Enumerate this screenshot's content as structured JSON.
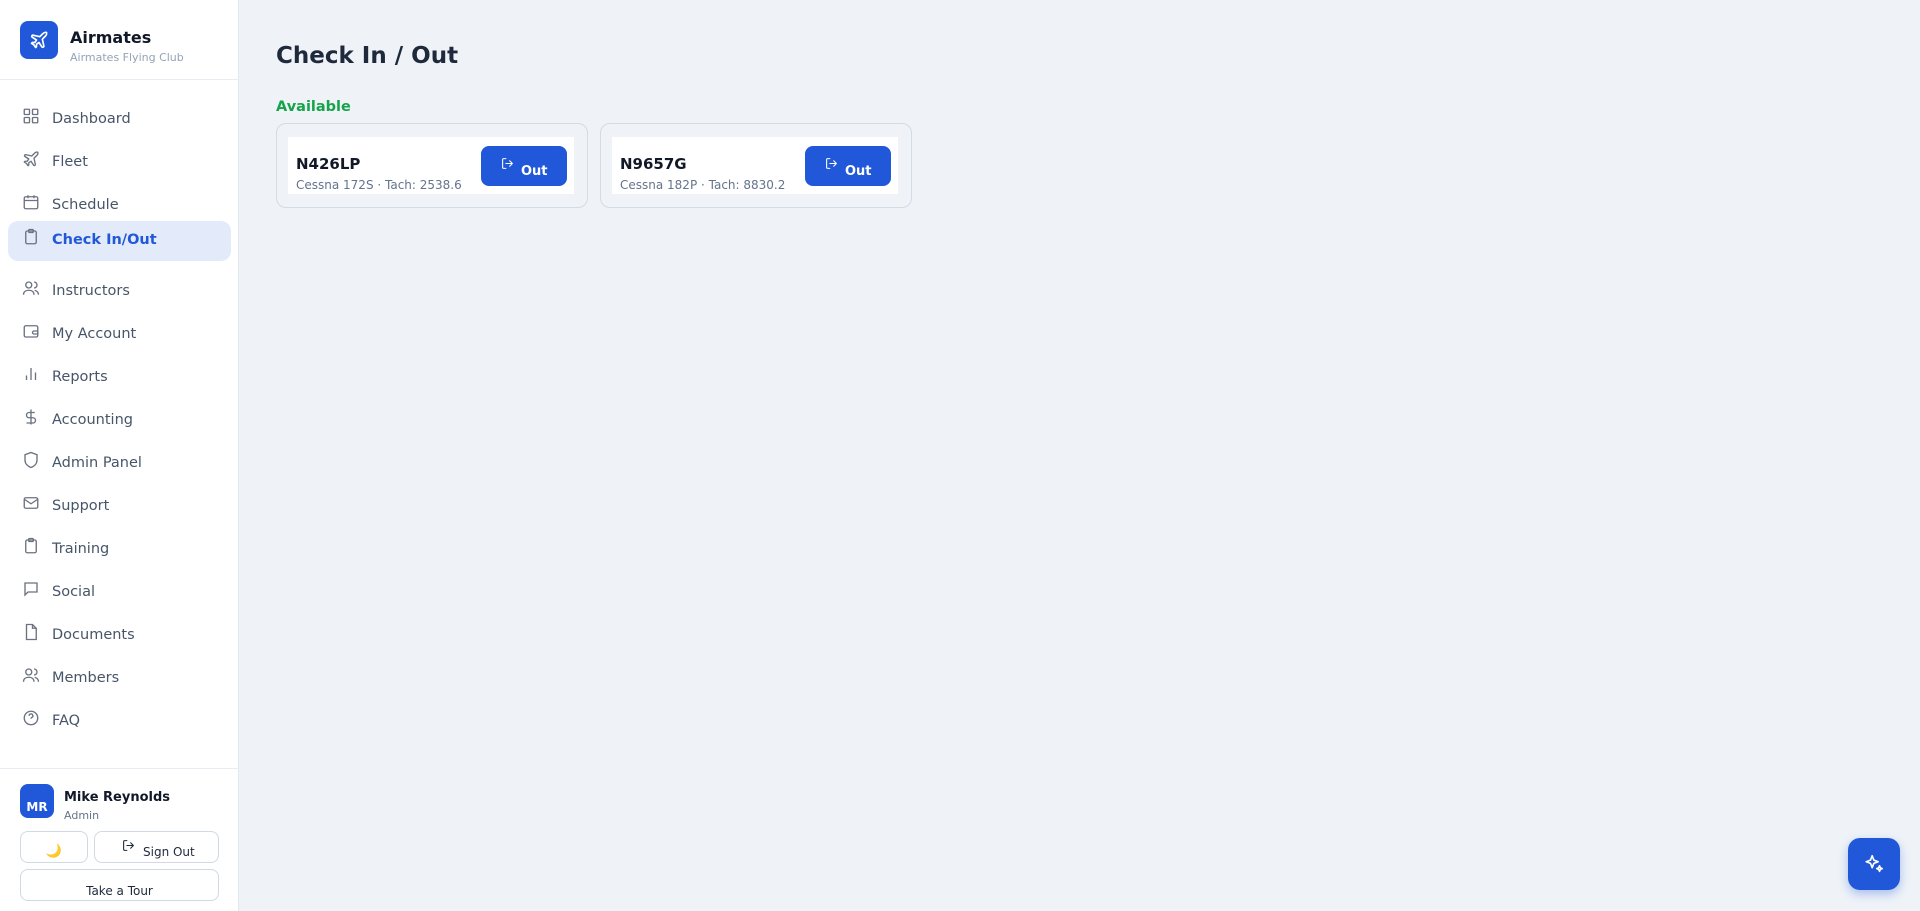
{
  "brand": {
    "name": "Airmates",
    "subtitle": "Airmates Flying Club",
    "logo_icon": "plane-icon"
  },
  "nav": [
    {
      "label": "Dashboard",
      "icon": "grid-icon",
      "active": false
    },
    {
      "label": "Fleet",
      "icon": "plane-icon",
      "active": false
    },
    {
      "label": "Schedule",
      "icon": "calendar-icon",
      "active": false
    },
    {
      "label": "Check In/Out",
      "icon": "clipboard-icon",
      "active": true
    },
    {
      "label": "Instructors",
      "icon": "users-icon",
      "active": false
    },
    {
      "label": "My Account",
      "icon": "wallet-icon",
      "active": false
    },
    {
      "label": "Reports",
      "icon": "bar-chart-icon",
      "active": false
    },
    {
      "label": "Accounting",
      "icon": "dollar-icon",
      "active": false
    },
    {
      "label": "Admin Panel",
      "icon": "shield-icon",
      "active": false
    },
    {
      "label": "Support",
      "icon": "mail-icon",
      "active": false
    },
    {
      "label": "Training",
      "icon": "clipboard-icon",
      "active": false
    },
    {
      "label": "Social",
      "icon": "message-icon",
      "active": false
    },
    {
      "label": "Documents",
      "icon": "file-icon",
      "active": false
    },
    {
      "label": "Members",
      "icon": "users-icon",
      "active": false
    },
    {
      "label": "FAQ",
      "icon": "help-circle-icon",
      "active": false
    }
  ],
  "user": {
    "initials": "MR",
    "name": "Mike Reynolds",
    "role": "Admin"
  },
  "actions": {
    "theme_icon": "🌙",
    "sign_out": "Sign Out",
    "tour": "Take a Tour"
  },
  "page": {
    "title": "Check In / Out",
    "section": "Available"
  },
  "aircraft": [
    {
      "tail": "N426LP",
      "details": "Cessna 172S · Tach: 2538.6",
      "action": "Out"
    },
    {
      "tail": "N9657G",
      "details": "Cessna 182P · Tach: 8830.2",
      "action": "Out"
    }
  ],
  "colors": {
    "accent": "#2158d9",
    "available": "#16a34a",
    "background": "#eff3f8"
  },
  "fab_icon": "sparkles-icon"
}
